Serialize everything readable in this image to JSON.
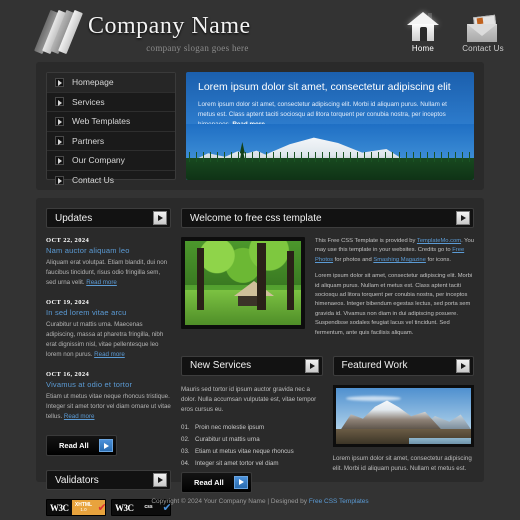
{
  "header": {
    "company_name": "Company Name",
    "slogan": "company slogan goes here",
    "logo_icon": "stripes-logo-icon",
    "nav": [
      {
        "label": "Home",
        "icon": "house-icon",
        "active": true
      },
      {
        "label": "Contact Us",
        "icon": "envelope-icon",
        "active": false
      }
    ]
  },
  "menu": {
    "items": [
      {
        "label": "Homepage",
        "active": true
      },
      {
        "label": "Services",
        "active": false
      },
      {
        "label": "Web Templates",
        "active": false
      },
      {
        "label": "Partners",
        "active": false
      },
      {
        "label": "Our Company",
        "active": false
      },
      {
        "label": "Contact Us",
        "active": false
      }
    ]
  },
  "banner": {
    "title": "Lorem ipsum dolor sit amet, consectetur adipiscing elit",
    "body": "Lorem ipsum dolor sit amet, consectetur adipiscing elit. Morbi id aliquam purus. Nullam et metus est. Class aptent taciti sociosqu ad litora torquent per conubia nostra, per inceptos himenaeos. ",
    "read_more": "Read more...",
    "image": "snow-mountain-forest-photo"
  },
  "updates": {
    "heading": "Updates",
    "items": [
      {
        "date": "OCT 22, 2024",
        "title": "Nam auctor aliquam leo",
        "body": "Aliquam erat volutpat. Etiam blandit, dui non faucibus tincidunt, risus odio fringilla sem, sed urna velit. ",
        "link": "Read more"
      },
      {
        "date": "OCT 19, 2024",
        "title": "In sed lorem vitae arcu",
        "body": "Curabitur ut mattis urna. Maecenas adipiscing, massa at pharetra fringilla, nibh erat dignissim nisl, vitae pellentesque leo lorem non purus. ",
        "link": "Read more"
      },
      {
        "date": "OCT 16, 2024",
        "title": "Vivamus at odio et tortor",
        "body": "Etiam ut metus vitae neque rhoncus tristique. Integer sit amet tortor vel diam ornare ut vitae tellus. ",
        "link": "Read more"
      }
    ],
    "read_all": "Read All"
  },
  "validators": {
    "heading": "Validators",
    "badges": [
      {
        "org": "W3C",
        "kind_top": "XHTML",
        "kind_bottom": "1.0",
        "type": "html"
      },
      {
        "org": "W3C",
        "kind_top": "css",
        "kind_bottom": "",
        "type": "css"
      }
    ]
  },
  "welcome": {
    "heading": "Welcome to free css template",
    "image": "green-park-gazebo-photo",
    "credit_1": "This Free CSS Template is provided by ",
    "credit_link_1": "TemplateMo.com",
    "credit_2": ". You may use this template in your websites. Credits go to ",
    "credit_link_2": "Free Photos",
    "credit_3": " for photos and ",
    "credit_link_3": "Smashing Magazine",
    "credit_4": " for icons.",
    "body": "Lorem ipsum dolor sit amet, consectetur adipiscing elit. Morbi id aliquam purus. Nullam et metus est. Class aptent taciti sociosqu ad litora torquent per conubia nostra, per inceptos himenaeos. Integer bibendum egestas lectus, sed porta sem gravida id. Vivamus non diam in dui adipiscing posuere. Suspendisse sodales feugiat lacus vel tincidunt. Sed fermentum, ante quis facilisis aliquam."
  },
  "new_services": {
    "heading": "New Services",
    "intro": "Mauris sed tortor id ipsum auctor gravida nec a dolor. Nulla accumsan vulputate est, vitae tempor eros cursus eu.",
    "items": [
      {
        "num": "01.",
        "text": "Proin nec molestie ipsum"
      },
      {
        "num": "02.",
        "text": "Curabitur ut mattis urna"
      },
      {
        "num": "03.",
        "text": "Etiam ut metus vitae neque rhoncus"
      },
      {
        "num": "04.",
        "text": "Integer sit amet tortor vel diam"
      }
    ],
    "read_all": "Read All"
  },
  "featured_work": {
    "heading": "Featured Work",
    "image": "snow-capped-mountain-photo",
    "caption": "Lorem ipsum dolor sit amet, consectetur adipiscing elit. Morbi id aliquam purus. Nullam et metus est."
  },
  "footer": {
    "copyright": "Copyright © 2024 Your Company Name  |  Designed by ",
    "designer_link": "Free CSS Templates"
  },
  "colors": {
    "page_bg": "#333333",
    "panel_bg": "#2a2a2a",
    "bar_bg": "#121212",
    "accent_blue": "#5b9bd5",
    "banner_blue": "#2f7fd0"
  }
}
